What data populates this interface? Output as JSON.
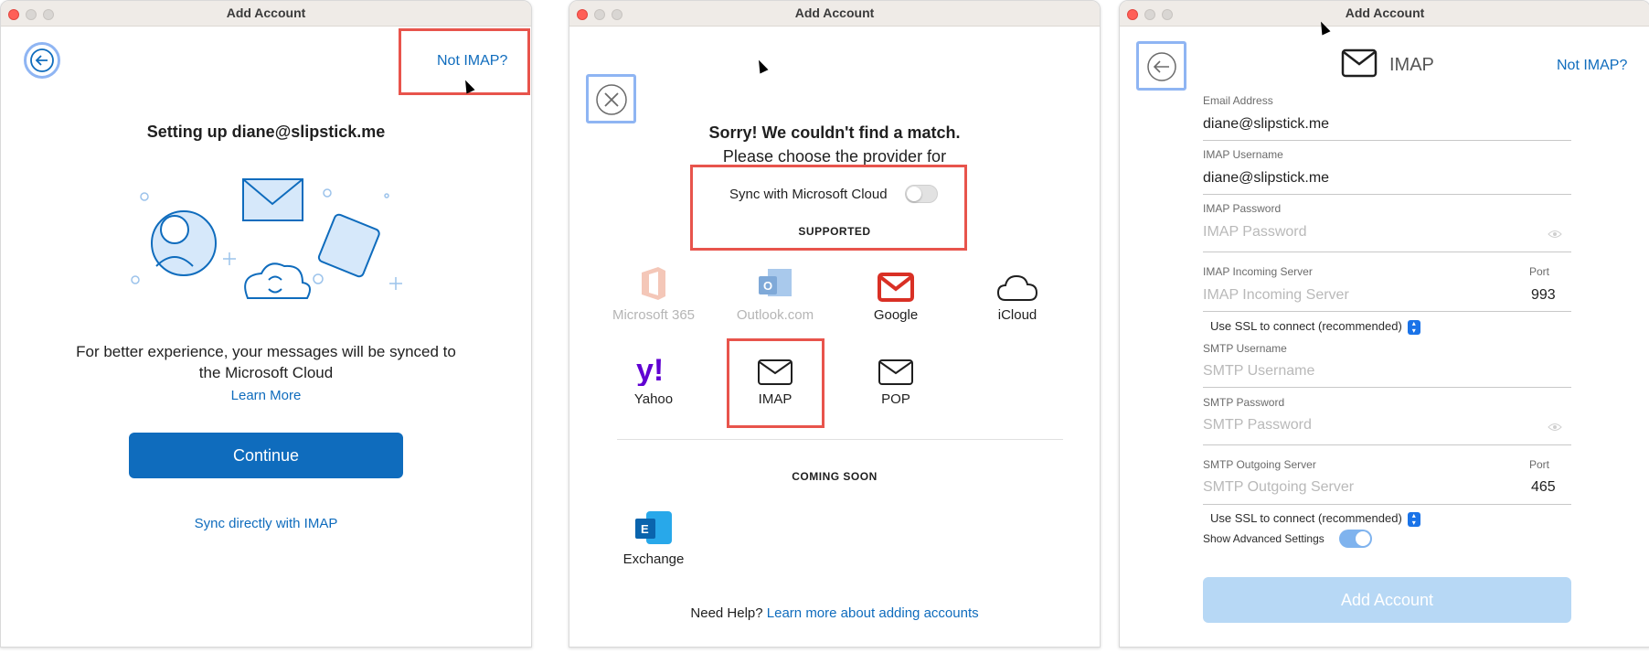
{
  "win1": {
    "title": "Add Account",
    "not_imap": "Not IMAP?",
    "heading": "Setting up diane@slipstick.me",
    "body_line1": "For better experience, your messages will be synced to",
    "body_line2": "the Microsoft Cloud",
    "learn_more": "Learn More",
    "continue": "Continue",
    "sync_imap": "Sync directly with IMAP"
  },
  "win2": {
    "title": "Add Account",
    "heading": "Sorry! We couldn't find a match.",
    "subheading": "Please choose the provider for",
    "sync_label": "Sync with Microsoft Cloud",
    "sync_on": false,
    "supported": "SUPPORTED",
    "providers": [
      {
        "label": "Microsoft 365",
        "icon": "office-icon",
        "enabled": false
      },
      {
        "label": "Outlook.com",
        "icon": "outlook-icon",
        "enabled": false
      },
      {
        "label": "Google",
        "icon": "gmail-icon",
        "enabled": true
      },
      {
        "label": "iCloud",
        "icon": "cloud-icon",
        "enabled": true
      },
      {
        "label": "Yahoo",
        "icon": "yahoo-icon",
        "enabled": true
      },
      {
        "label": "IMAP",
        "icon": "envelope-icon",
        "enabled": true
      },
      {
        "label": "POP",
        "icon": "envelope-icon",
        "enabled": true
      }
    ],
    "coming_soon": "COMING SOON",
    "exchange": "Exchange",
    "need_help": "Need Help?",
    "help_link": "Learn more about adding accounts"
  },
  "win3": {
    "title": "Add Account",
    "header_label": "IMAP",
    "not_imap": "Not IMAP?",
    "email_label": "Email Address",
    "email_value": "diane@slipstick.me",
    "imap_user_label": "IMAP Username",
    "imap_user_value": "diane@slipstick.me",
    "imap_pass_label": "IMAP Password",
    "imap_pass_placeholder": "IMAP Password",
    "imap_server_label": "IMAP Incoming Server",
    "imap_server_placeholder": "IMAP Incoming Server",
    "port_label": "Port",
    "imap_port": "993",
    "ssl_label": "Use SSL to connect (recommended)",
    "smtp_user_label": "SMTP Username",
    "smtp_user_placeholder": "SMTP Username",
    "smtp_pass_label": "SMTP Password",
    "smtp_pass_placeholder": "SMTP Password",
    "smtp_server_label": "SMTP Outgoing Server",
    "smtp_server_placeholder": "SMTP Outgoing Server",
    "smtp_port": "465",
    "advanced_label": "Show Advanced Settings",
    "advanced_on": true,
    "add_account": "Add Account"
  },
  "colors": {
    "accent": "#0f6cbd",
    "highlight": "#e8544c",
    "focus": "#8fb5f3",
    "disabled_button": "#b7d8f5"
  }
}
